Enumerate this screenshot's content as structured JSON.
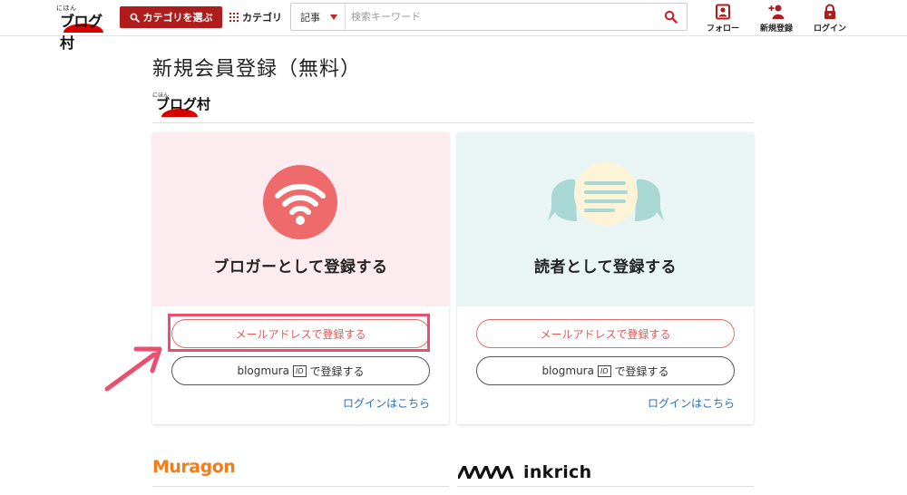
{
  "header": {
    "logo_small": "にほん",
    "logo_main": "ブログ村",
    "category_select_label": "カテゴリを選ぶ",
    "category_link_label": "カテゴリ",
    "search_type": "記事",
    "search_placeholder": "検索キーワード",
    "follow_label": "フォロー",
    "register_label": "新規登録",
    "login_label": "ログイン",
    "accent_color": "#b01b1b"
  },
  "main": {
    "title": "新規会員登録（無料）",
    "brand_small": "にほん",
    "brand_main": "ブログ村",
    "cards": [
      {
        "title": "ブロガーとして登録する",
        "icon": "wifi-icon",
        "mail_button": "メールアドレスで登録する",
        "id_prefix": "blogmura",
        "id_badge": "ID",
        "id_suffix": "で登録する",
        "login_link": "ログインはこちら"
      },
      {
        "title": "読者として登録する",
        "icon": "chat-bubbles-icon",
        "mail_button": "メールアドレスで登録する",
        "id_prefix": "blogmura",
        "id_badge": "ID",
        "id_suffix": "で登録する",
        "login_link": "ログインはこちら"
      }
    ],
    "services": {
      "muragon": "Muragon",
      "inkrich": "inkrich"
    }
  }
}
